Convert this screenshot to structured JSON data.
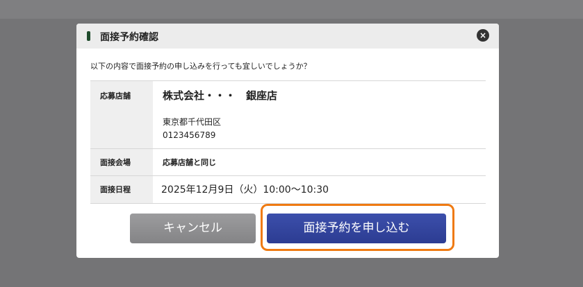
{
  "modal": {
    "title": "面接予約確認",
    "close_symbol": "×",
    "prompt": "以下の内容で面接予約の申し込みを行っても宜しいでしょうか？"
  },
  "details": {
    "store_label": "応募店舗",
    "store_name": "株式会社・・・　銀座店",
    "store_address": "東京都千代田区",
    "store_phone": "0123456789",
    "venue_label": "面接会場",
    "venue_value": "応募店舗と同じ",
    "date_label": "面接日程",
    "date_value": "2025年12月9日（火）10:00〜10:30"
  },
  "buttons": {
    "cancel": "キャンセル",
    "submit": "面接予約を申し込む"
  },
  "colors": {
    "submit": "#3445a0",
    "cancel": "#8e8e90",
    "highlight": "#ef7a12",
    "title_mark": "#1f4b2c"
  },
  "icons": {
    "close": "close-icon"
  }
}
